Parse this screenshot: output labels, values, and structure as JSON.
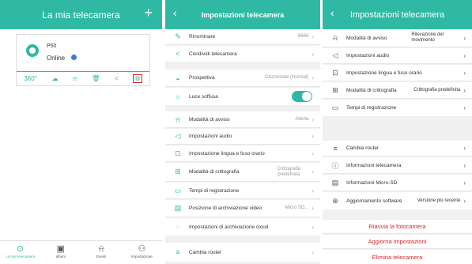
{
  "screen1": {
    "title": "La mia telecamera",
    "add_icon": "+",
    "device": {
      "name": "P50",
      "status": "Online"
    },
    "toolbar_icons": [
      "360-icon",
      "cloud-icon",
      "mute-icon",
      "trash-icon",
      "share-icon",
      "settings-icon"
    ],
    "toolbar_360": "360°",
    "tabs": [
      {
        "label": "La mia telecamera",
        "icon": "⊙"
      },
      {
        "label": "album",
        "icon": "▣"
      },
      {
        "label": "Eventi",
        "icon": "⍾"
      },
      {
        "label": "Impostazione",
        "icon": "⚇"
      }
    ]
  },
  "screen2": {
    "back": "‹",
    "title": "Impostazioni telecamera",
    "rows": [
      {
        "icon": "✎",
        "label": "Rinominare",
        "value": "6666"
      },
      {
        "icon": "<",
        "label": "Condividi telecamera",
        "value": ""
      },
      {
        "icon": "◒",
        "label": "Prospettiva",
        "value": "Orizzontale (Normal)"
      },
      {
        "icon": "☼",
        "label": "Luce soffusa",
        "value": ""
      },
      {
        "icon": "⍾",
        "label": "Modalità di avviso",
        "value": "Allerta"
      },
      {
        "icon": "◁",
        "label": "Impostazioni audio",
        "value": ""
      },
      {
        "icon": "⊡",
        "label": "Impostazione lingua e fuso orario",
        "value": ""
      },
      {
        "icon": "⊞",
        "label": "Modalità di crittografia",
        "value": "Crittografia predefinita"
      },
      {
        "icon": "▭",
        "label": "Tempi di registrazione",
        "value": ""
      },
      {
        "icon": "▤",
        "label": "Posizione di archiviazione video",
        "value": "Micro SD..."
      },
      {
        "icon": "◌",
        "label": "Impostazioni di archiviazione cloud",
        "value": ""
      },
      {
        "icon": "≡",
        "label": "Cambia router",
        "value": ""
      }
    ]
  },
  "screen3": {
    "back": "‹",
    "title": "Impostazioni telecamera",
    "rows": [
      {
        "icon": "⍾",
        "label": "Modalità di avviso",
        "value": "Rilevazione del movimento"
      },
      {
        "icon": "◁",
        "label": "Impostazioni audio",
        "value": ""
      },
      {
        "icon": "⊡",
        "label": "Impostazione lingua e fuso orario",
        "value": ""
      },
      {
        "icon": "⊞",
        "label": "Modalità di crittografia",
        "value": "Crittografia predefinita"
      },
      {
        "icon": "▭",
        "label": "Tempi di registrazione",
        "value": ""
      },
      {
        "icon": "≡",
        "label": "Cambia router",
        "value": ""
      },
      {
        "icon": "ⓘ",
        "label": "Informazioni telecamera",
        "value": ""
      },
      {
        "icon": "▤",
        "label": "Informazioni Micro-SD",
        "value": ""
      },
      {
        "icon": "⊕",
        "label": "Aggiornamento software",
        "value": "Versione più recente"
      }
    ],
    "actions": [
      "Riavvia la fotocamera",
      "Aggiorna impostazioni",
      "Elimina telecamera"
    ]
  },
  "chevron": "›",
  "accent_color": "#2fb9a4",
  "danger_color": "#d9262c"
}
